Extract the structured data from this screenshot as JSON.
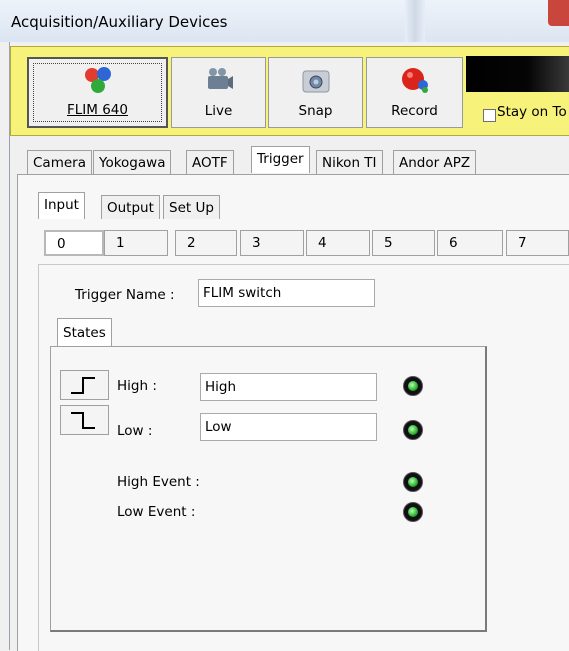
{
  "window": {
    "title": "Acquisition/Auxiliary Devices"
  },
  "toolbar": {
    "buttons": [
      {
        "label": "FLIM 640",
        "icon": "flim-molecule-icon"
      },
      {
        "label": "Live",
        "icon": "video-camera-icon"
      },
      {
        "label": "Snap",
        "icon": "photo-camera-icon"
      },
      {
        "label": "Record",
        "icon": "record-icon"
      }
    ],
    "stay_on_top": "Stay on To",
    "accent_color": "#f6f27a"
  },
  "device_tabs": [
    "Camera",
    "Yokogawa",
    "AOTF",
    "Trigger",
    "Nikon TI",
    "Andor APZ"
  ],
  "active_device_tab": "Trigger",
  "io_tabs": [
    "Input",
    "Output",
    "Set Up"
  ],
  "active_io_tab": "Input",
  "channels": [
    "0",
    "1",
    "2",
    "3",
    "4",
    "5",
    "6",
    "7"
  ],
  "active_channel": "0",
  "trigger": {
    "name_label": "Trigger Name :",
    "name_value": "FLIM switch",
    "states_tab": "States",
    "high_label": "High :",
    "high_value": "High",
    "low_label": "Low :",
    "low_value": "Low",
    "high_event_label": "High Event :",
    "low_event_label": "Low Event :"
  }
}
